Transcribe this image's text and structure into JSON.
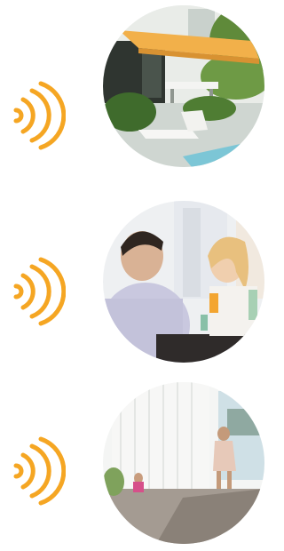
{
  "accent_color": "#f5a623",
  "icon": "wifi-signal-icon",
  "scenes": [
    {
      "name": "patio-awning-photo",
      "description_icon": "patio-awning"
    },
    {
      "name": "couple-dining-photo",
      "description_icon": "dining-couple"
    },
    {
      "name": "living-room-curtains-photo",
      "description_icon": "living-room"
    }
  ]
}
